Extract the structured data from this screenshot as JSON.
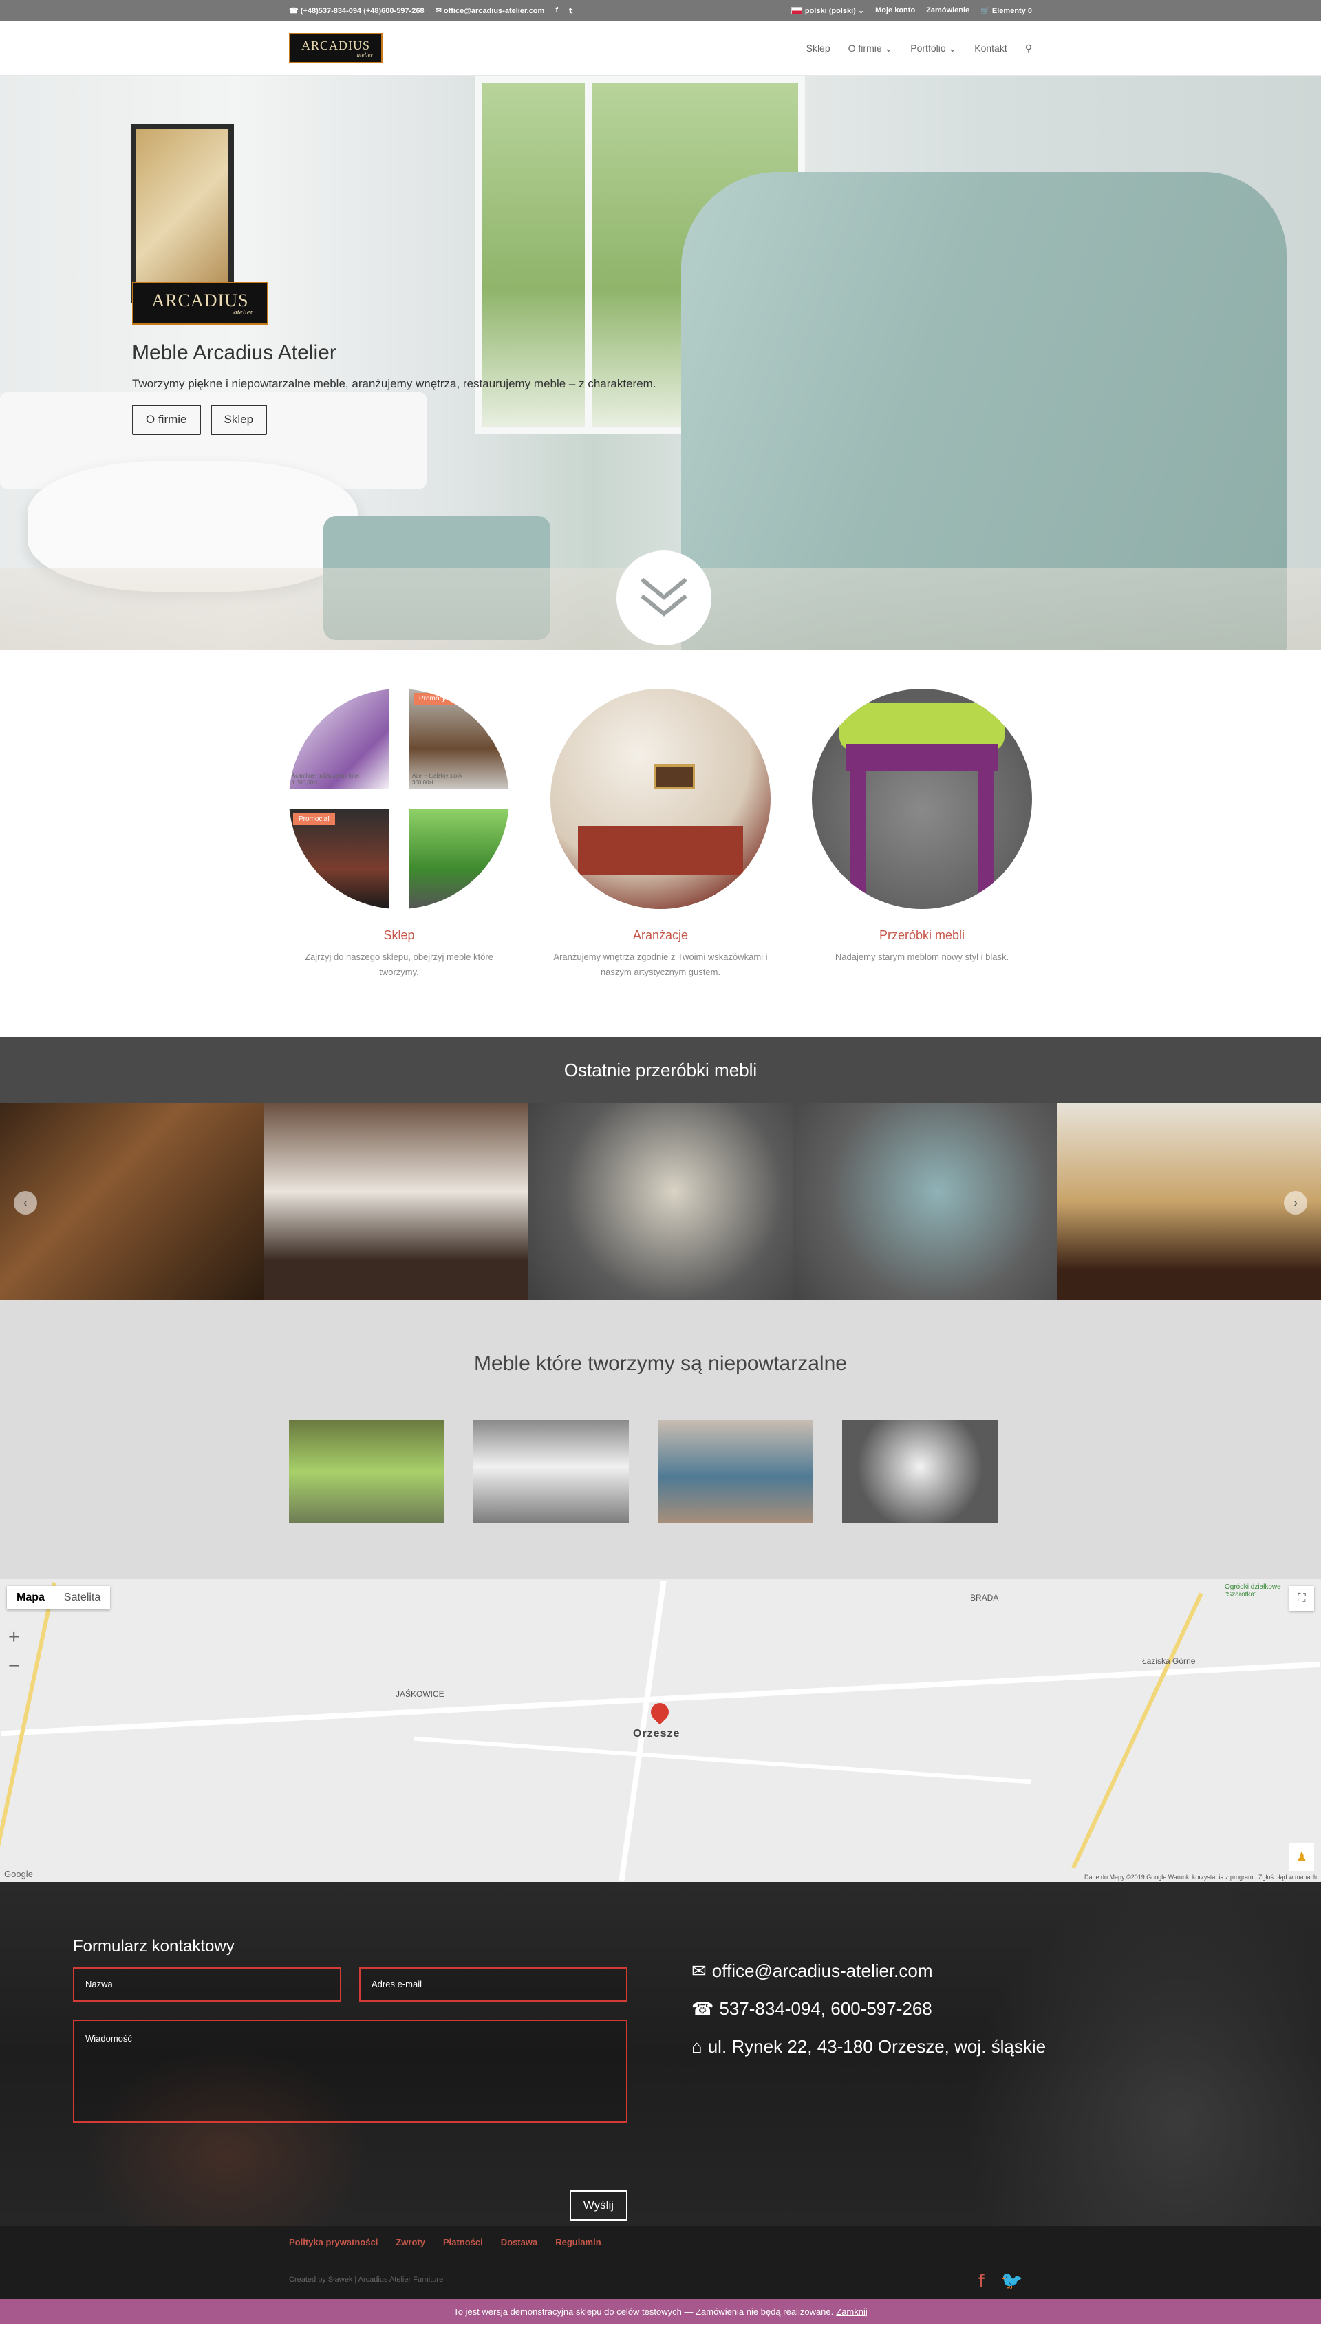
{
  "topbar": {
    "phones": "(+48)537-834-094 (+48)600-597-268",
    "email": "office@arcadius-atelier.com",
    "language": "polski (polski)",
    "account": "Moje konto",
    "orders": "Zamówienie",
    "cart": "Elementy 0"
  },
  "logo": {
    "line1": "ARCADIUS",
    "line2": "atelier"
  },
  "nav": {
    "items": [
      {
        "label": "Sklep"
      },
      {
        "label": "O firmie"
      },
      {
        "label": "Portfolio"
      },
      {
        "label": "Kontakt"
      }
    ]
  },
  "hero": {
    "logo_line1": "ARCADIUS",
    "logo_line2": "atelier",
    "title": "Meble Arcadius Atelier",
    "subtitle": "Tworzymy piękne i niepowtarzalne meble, aranżujemy wnętrza, restaurujemy meble – z charakterem.",
    "btn_about": "O firmie",
    "btn_shop": "Sklep"
  },
  "features": [
    {
      "title": "Sklep",
      "text": "Zajrzyj do naszego sklepu, obejrzyj meble które tworzymy."
    },
    {
      "title": "Aranżacje",
      "text": "Aranżujemy wnętrza zgodnie z Twoimi wskazówkami i naszym artystycznym gustem."
    },
    {
      "title": "Przeróbki mebli",
      "text": "Nadajemy starym meblom nowy styl i blask."
    }
  ],
  "shop_tiles": {
    "product1_name": "Acanthus- tulkauszeny fotel",
    "product1_price": "1.800,00zł",
    "product2_name": "Acel – tualetny stolik",
    "product2_price": "300,00zł",
    "promo_label": "Promocja!"
  },
  "latest": {
    "title": "Ostatnie przeróbki mebli"
  },
  "unique": {
    "title": "Meble które tworzymy są niepowtarzalne"
  },
  "map": {
    "tab_map": "Mapa",
    "tab_satellite": "Satelita",
    "city": "Orzesze",
    "labels": [
      "JAŚKOWICE",
      "BRADA",
      "Łaziska Górne",
      "Ogródki działkowe \"Szarotka\""
    ],
    "footer": "Dane do Mapy ©2019 Google   Warunki korzystania z programu   Zgłoś błąd w mapach",
    "google": "Google"
  },
  "contact": {
    "title": "Formularz kontaktowy",
    "name_placeholder": "Nazwa",
    "email_placeholder": "Adres e-mail",
    "message_placeholder": "Wiadomość",
    "send": "Wyślij",
    "email": "office@arcadius-atelier.com",
    "phones": "537-834-094, 600-597-268",
    "address": "ul. Rynek 22, 43-180 Orzesze, woj. śląskie"
  },
  "footer": {
    "links": [
      {
        "label": "Polityka prywatności"
      },
      {
        "label": "Zwroty"
      },
      {
        "label": "Płatności"
      },
      {
        "label": "Dostawa"
      },
      {
        "label": "Regulamin"
      }
    ],
    "credits": "Created by Sławek | Arcadius Atelier Furniture"
  },
  "demo": {
    "text": "To jest wersja demonstracyjna sklepu do celów testowych — Zamówienia nie będą realizowane.",
    "dismiss": "Zamknij"
  },
  "colors": {
    "accent": "#c6574a",
    "topbar": "#777777",
    "demo_banner": "#a7588c",
    "form_border": "#d43b35"
  }
}
